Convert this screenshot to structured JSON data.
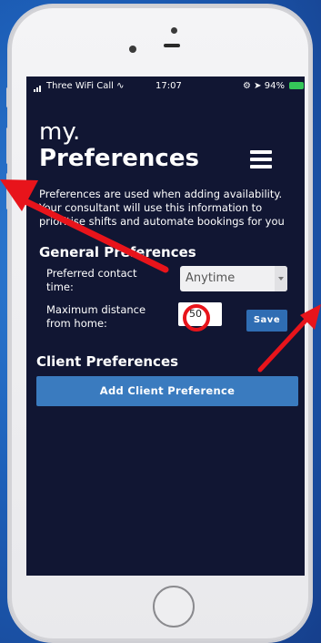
{
  "status_bar": {
    "carrier": "Three WiFi Call",
    "time": "17:07",
    "battery": "94%"
  },
  "header": {
    "title_prefix": "my.",
    "title": "Preferences",
    "menu_icon": "hamburger-icon"
  },
  "intro": {
    "text": "Preferences are used when adding availability. Your consultant will use this information to prioritise shifts and automate bookings for you"
  },
  "general_preferences": {
    "title": "General Preferences",
    "contact_time": {
      "label": "Preferred contact time:",
      "selected_value": "Anytime"
    },
    "max_distance": {
      "label": "Maximum distance from home:",
      "value": "50"
    },
    "save_label": "Save"
  },
  "client_preferences": {
    "title": "Client Preferences",
    "add_button_label": "Add Client Preference"
  },
  "colors": {
    "screen_bg": "#111633",
    "button_blue": "#3a7bbf",
    "annotation_red": "#e8141b"
  }
}
